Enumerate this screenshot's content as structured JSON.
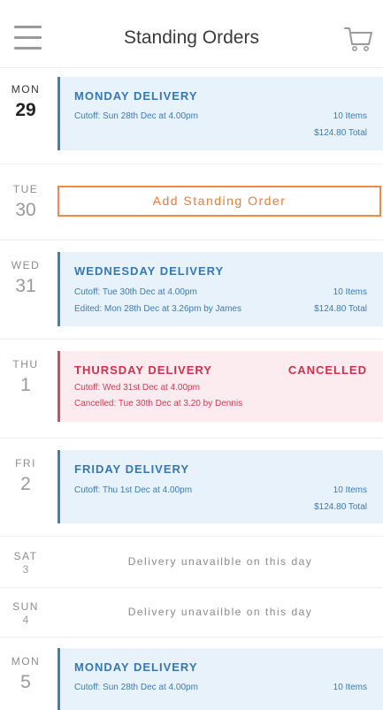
{
  "header": {
    "title": "Standing Orders",
    "menu_icon": "hamburger-menu-icon",
    "cart_icon": "cart-icon"
  },
  "colors": {
    "delivery_accent": "#3578b5",
    "delivery_bg": "#e8f2fb",
    "cancelled_accent": "#d22f4d",
    "cancelled_bg": "#fdecef",
    "add_button": "#ec7b34"
  },
  "days": [
    {
      "dow": "MON",
      "num": "29",
      "card": {
        "title": "MONDAY DELIVERY",
        "cutoff": "Cutoff: Sun 28th Dec at 4.00pm",
        "items": "10 Items",
        "total": "$124.80 Total"
      }
    },
    {
      "dow": "TUE",
      "num": "30",
      "add_label": "Add Standing Order"
    },
    {
      "dow": "WED",
      "num": "31",
      "card": {
        "title": "WEDNESDAY DELIVERY",
        "cutoff": "Cutoff: Tue 30th Dec at 4.00pm",
        "edited": "Edited: Mon 28th Dec at 3.26pm by James",
        "items": "10 Items",
        "total": "$124.80 Total"
      }
    },
    {
      "dow": "THU",
      "num": "1",
      "card": {
        "title": "THURSDAY DELIVERY",
        "status": "CANCELLED",
        "cutoff": "Cutoff: Wed 31st Dec at 4.00pm",
        "cancelled": "Cancelled: Tue 30th Dec at 3.20 by Dennis"
      }
    },
    {
      "dow": "FRI",
      "num": "2",
      "card": {
        "title": "FRIDAY DELIVERY",
        "cutoff": "Cutoff: Thu 1st Dec at 4.00pm",
        "items": "10 Items",
        "total": "$124.80 Total"
      }
    },
    {
      "dow": "SAT",
      "num": "3",
      "message": "Delivery unavailble on this day"
    },
    {
      "dow": "SUN",
      "num": "4",
      "message": "Delivery unavailble on this day"
    },
    {
      "dow": "MON",
      "num": "5",
      "card": {
        "title": "MONDAY DELIVERY",
        "cutoff": "Cutoff: Sun 28th Dec at 4.00pm",
        "items": "10 Items"
      }
    }
  ]
}
